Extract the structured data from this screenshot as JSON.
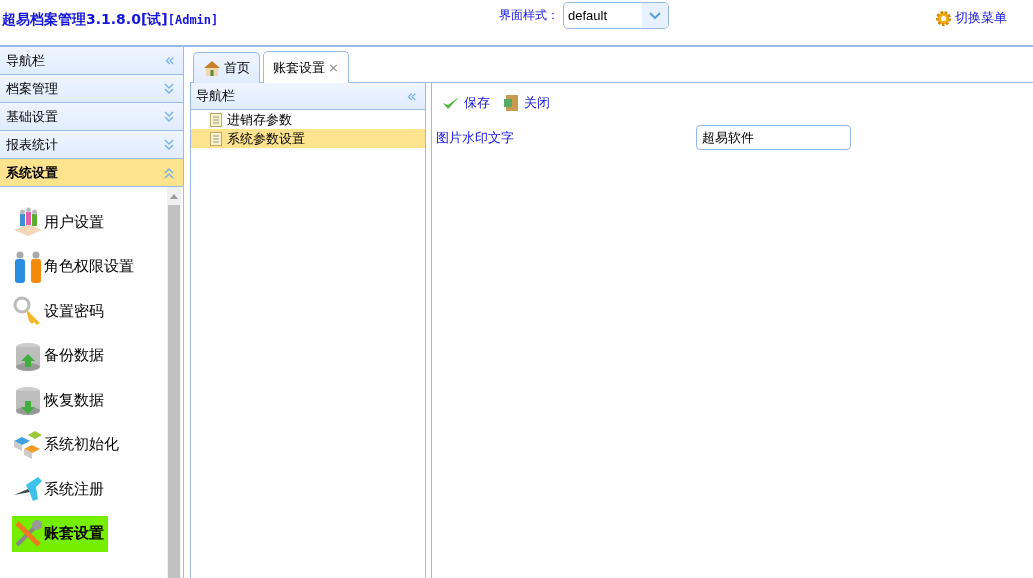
{
  "header": {
    "title": "超易档案管理3.1.8.0[试]",
    "user": "[Admin]",
    "style_label": "界面样式：",
    "style_value": "default",
    "switch_menu": "切换菜单"
  },
  "sidebar": {
    "title": "导航栏",
    "title_icon": "«",
    "sections": [
      {
        "label": "档案管理",
        "expanded": false
      },
      {
        "label": "基础设置",
        "expanded": false
      },
      {
        "label": "报表统计",
        "expanded": false
      },
      {
        "label": "系统设置",
        "expanded": true
      }
    ],
    "items": [
      {
        "label": "用户设置",
        "selected": false
      },
      {
        "label": "角色权限设置",
        "selected": false
      },
      {
        "label": "设置密码",
        "selected": false
      },
      {
        "label": "备份数据",
        "selected": false
      },
      {
        "label": "恢复数据",
        "selected": false
      },
      {
        "label": "系统初始化",
        "selected": false
      },
      {
        "label": "系统注册",
        "selected": false
      },
      {
        "label": "账套设置",
        "selected": true
      }
    ]
  },
  "tabs": [
    {
      "label": "首页",
      "selected": false
    },
    {
      "label": "账套设置",
      "selected": true,
      "close": "×"
    }
  ],
  "nav_panel": {
    "title": "导航栏",
    "collapse": "«",
    "items": [
      {
        "label": "进销存参数",
        "selected": false
      },
      {
        "label": "系统参数设置",
        "selected": true
      }
    ]
  },
  "toolbar": [
    {
      "label": "保存",
      "kind": "save"
    },
    {
      "label": "关闭",
      "kind": "close"
    }
  ],
  "form": [
    {
      "label": "图片水印文字",
      "value": "超易软件"
    }
  ]
}
